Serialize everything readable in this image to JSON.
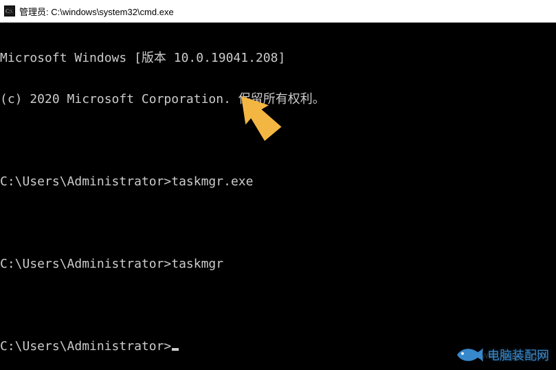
{
  "titlebar": {
    "title": "管理员: C:\\windows\\system32\\cmd.exe"
  },
  "terminal": {
    "version_line": "Microsoft Windows [版本 10.0.19041.208]",
    "copyright_line": "(c) 2020 Microsoft Corporation. 保留所有权利。",
    "prompt1": "C:\\Users\\Administrator>",
    "command1": "taskmgr.exe",
    "prompt2": "C:\\Users\\Administrator>",
    "command2": "taskmgr",
    "prompt3": "C:\\Users\\Administrator>"
  },
  "overlay": {
    "arrow_color": "#f4b642"
  },
  "watermarks": {
    "w1_text": "电脑装配网",
    "w2_text": "www.xajjn.com"
  }
}
